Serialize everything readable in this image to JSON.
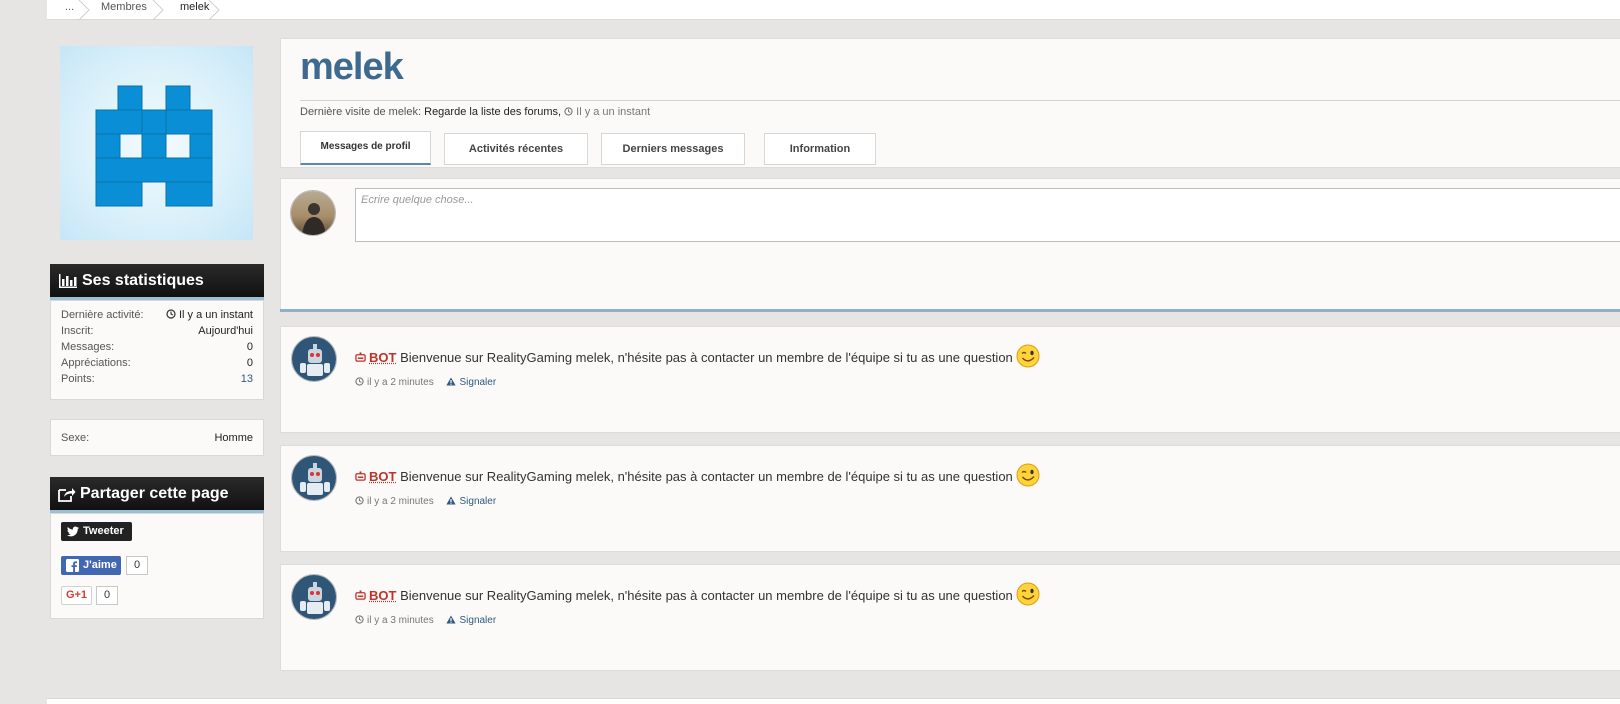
{
  "breadcrumb": {
    "home": "...",
    "section": "Membres",
    "current": "melek"
  },
  "profile": {
    "username": "melek",
    "last_visit_label": "Dernière visite de melek:",
    "last_visit_place": "Regarde la liste des forums,",
    "last_visit_time": "Il y a un instant"
  },
  "tabs": [
    {
      "label": "Messages de profil",
      "active": true
    },
    {
      "label": "Activités récentes",
      "active": false
    },
    {
      "label": "Derniers messages",
      "active": false
    },
    {
      "label": "Information",
      "active": false
    }
  ],
  "stats": {
    "title": "Ses statistiques",
    "rows": [
      {
        "label": "Dernière activité:",
        "value": "Il y a un instant"
      },
      {
        "label": "Inscrit:",
        "value": "Aujourd'hui"
      },
      {
        "label": "Messages:",
        "value": "0"
      },
      {
        "label": "Appréciations:",
        "value": "0"
      },
      {
        "label": "Points:",
        "value": "13"
      }
    ]
  },
  "info": {
    "sex_label": "Sexe:",
    "sex_value": "Homme"
  },
  "share": {
    "title": "Partager cette page",
    "tweet_label": "Tweeter",
    "like_label": "J'aime",
    "like_count": "0",
    "gplus_label": "G+1",
    "gplus_count": "0"
  },
  "post_box": {
    "placeholder": "Ecrire quelque chose..."
  },
  "messages": [
    {
      "tag": "BOT",
      "text": "Bienvenue sur RealityGaming melek, n'hésite pas à contacter un membre de l'équipe si tu as une question",
      "time": "il y a 2 minutes",
      "report": "Signaler"
    },
    {
      "tag": "BOT",
      "text": "Bienvenue sur RealityGaming melek, n'hésite pas à contacter un membre de l'équipe si tu as une question",
      "time": "il y a 2 minutes",
      "report": "Signaler"
    },
    {
      "tag": "BOT",
      "text": "Bienvenue sur RealityGaming melek, n'hésite pas à contacter un membre de l'équipe si tu as une question",
      "time": "il y a 3 minutes",
      "report": "Signaler"
    }
  ],
  "colors": {
    "accent": "#3f6a8f",
    "link": "#2e5a84",
    "bot": "#c0332b",
    "avatar_blue": "#0a8fd6"
  },
  "icons": {
    "stats": "bar-chart-icon",
    "share": "share-icon",
    "clock": "clock-icon",
    "report": "warning-icon",
    "bot": "robot-icon",
    "emoji": "wink-smiley-icon"
  }
}
